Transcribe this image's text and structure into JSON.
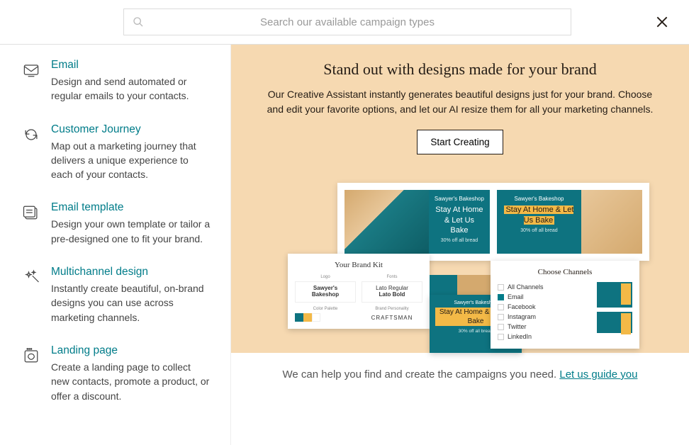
{
  "search": {
    "placeholder": "Search our available campaign types"
  },
  "sidebar": {
    "items": [
      {
        "title": "Email",
        "desc": "Design and send automated or regular emails to your contacts."
      },
      {
        "title": "Customer Journey",
        "desc": "Map out a marketing journey that delivers a unique experience to each of your contacts."
      },
      {
        "title": "Email template",
        "desc": "Design your own template or tailor a pre-designed one to fit your brand."
      },
      {
        "title": "Multichannel design",
        "desc": "Instantly create beautiful, on-brand designs you can use across marketing channels."
      },
      {
        "title": "Landing page",
        "desc": "Create a landing page to collect new contacts, promote a product, or offer a discount."
      }
    ]
  },
  "hero": {
    "title": "Stand out with designs made for your brand",
    "desc": "Our Creative Assistant instantly generates beautiful designs just for your brand. Choose and edit your favorite options, and let our AI resize them for all your marketing channels.",
    "cta": "Start Creating"
  },
  "preview": {
    "tile_brand": "Sawyer's Bakeshop",
    "tile_headline": "Stay At Home & Let Us Bake",
    "tile_sub": "30% off all bread",
    "brandkit": {
      "title": "Your Brand Kit",
      "logo_label": "Logo",
      "logo_text": "Sawyer's Bakeshop",
      "fonts_label": "Fonts",
      "fonts_text1": "Lato Regular",
      "fonts_text2": "Lato Bold",
      "palette_label": "Color Palette",
      "personality_label": "Brand Personality",
      "personality_text": "CRAFTSMAN",
      "palette": [
        "#0e7380",
        "#f3b947",
        "#ffffff"
      ]
    },
    "channels": {
      "title": "Choose Channels",
      "list": [
        {
          "label": "All Channels",
          "checked": false
        },
        {
          "label": "Email",
          "checked": true
        },
        {
          "label": "Facebook",
          "checked": false
        },
        {
          "label": "Instagram",
          "checked": false
        },
        {
          "label": "Twitter",
          "checked": false
        },
        {
          "label": "LinkedIn",
          "checked": false
        }
      ]
    }
  },
  "footer": {
    "text": "We can help you find and create the campaigns you need. ",
    "link": "Let us guide you"
  }
}
